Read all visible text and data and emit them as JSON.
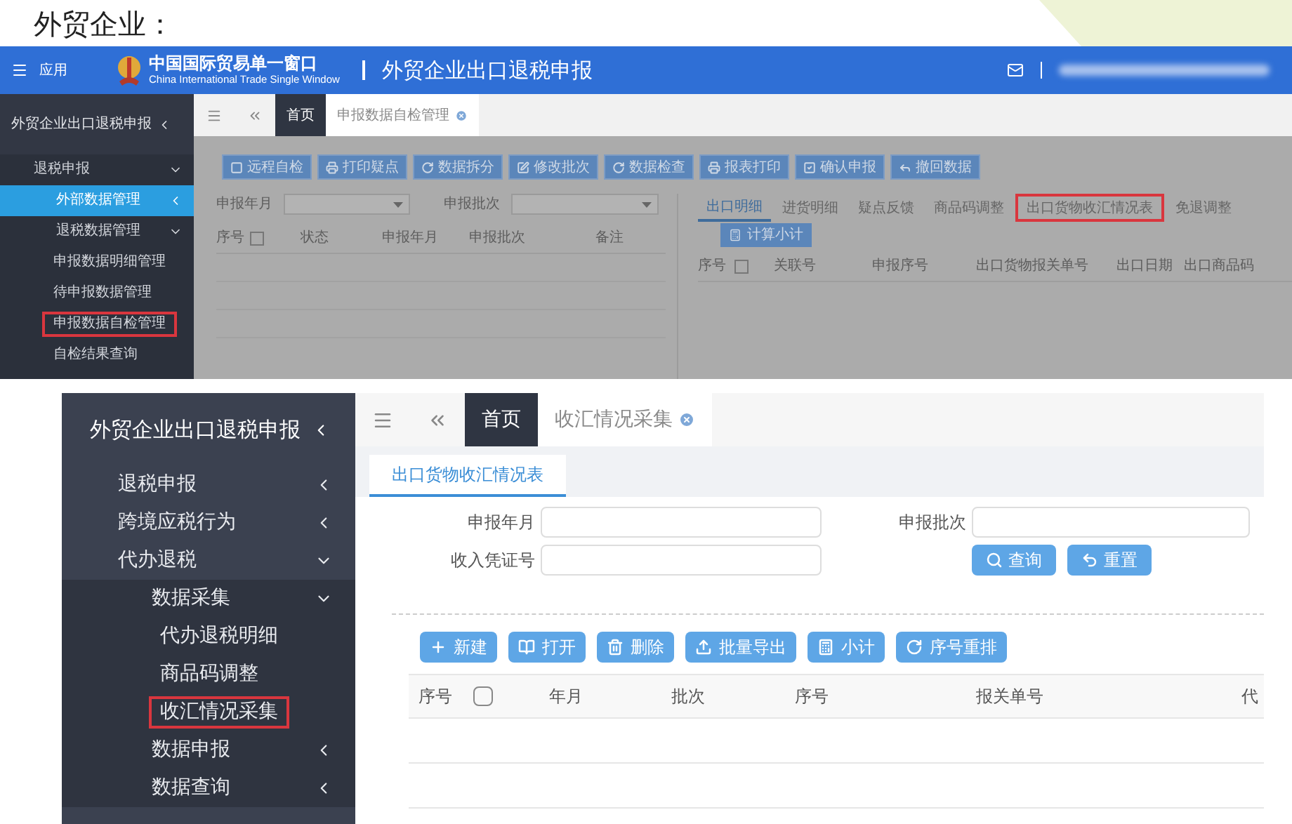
{
  "slide_title": "外贸企业：",
  "top_window": {
    "header": {
      "menu_label": "应用",
      "logo_title": "中国国际贸易单一窗口",
      "logo_subtitle": "China International Trade Single Window",
      "app_title": "外贸企业出口退税申报"
    },
    "sidebar": {
      "title": "外贸企业出口退税申报",
      "items": [
        {
          "label": "退税申报",
          "expanded": true,
          "selected": false,
          "highlighted": false,
          "children": [
            {
              "label": "外部数据管理",
              "expanded": false,
              "selected": true,
              "highlighted": false
            },
            {
              "label": "退税数据管理",
              "expanded": true,
              "selected": false,
              "highlighted": false,
              "children": [
                {
                  "label": "申报数据明细管理",
                  "selected": false,
                  "highlighted": false
                },
                {
                  "label": "待申报数据管理",
                  "selected": false,
                  "highlighted": false
                },
                {
                  "label": "申报数据自检管理",
                  "selected": false,
                  "highlighted": true
                },
                {
                  "label": "自检结果查询",
                  "selected": false,
                  "highlighted": false
                }
              ]
            }
          ]
        }
      ]
    },
    "tabs": [
      {
        "label": "首页",
        "selected": true,
        "closable": false
      },
      {
        "label": "申报数据自检管理",
        "selected": false,
        "closable": true
      }
    ],
    "toolbar": [
      {
        "label": "远程自检",
        "kind": "check"
      },
      {
        "label": "打印疑点",
        "kind": "print"
      },
      {
        "label": "数据拆分",
        "kind": "refresh"
      },
      {
        "label": "修改批次",
        "kind": "edit"
      },
      {
        "label": "数据检查",
        "kind": "refresh"
      },
      {
        "label": "报表打印",
        "kind": "print"
      },
      {
        "label": "确认申报",
        "kind": "confirm"
      },
      {
        "label": "撤回数据",
        "kind": "undo"
      }
    ],
    "filters": [
      {
        "label": "申报年月"
      },
      {
        "label": "申报批次"
      }
    ],
    "left_table": {
      "select_all_checked": false,
      "columns": [
        "序号",
        "状态",
        "申报年月",
        "申报批次",
        "备注"
      ]
    },
    "detail_tabs": [
      {
        "label": "出口明细",
        "selected": true,
        "highlighted": false
      },
      {
        "label": "进货明细",
        "selected": false,
        "highlighted": false
      },
      {
        "label": "疑点反馈",
        "selected": false,
        "highlighted": false
      },
      {
        "label": "商品码调整",
        "selected": false,
        "highlighted": false
      },
      {
        "label": "出口货物收汇情况表",
        "selected": false,
        "highlighted": true
      },
      {
        "label": "免退调整",
        "selected": false,
        "highlighted": false
      }
    ],
    "subtotal_button": "计算小计",
    "right_table": {
      "select_all_checked": false,
      "columns": [
        "序号",
        "关联号",
        "申报序号",
        "出口货物报关单号",
        "出口日期",
        "出口商品码"
      ]
    }
  },
  "bottom_window": {
    "sidebar": {
      "title": "外贸企业出口退税申报",
      "items": [
        {
          "label": "退税申报",
          "expanded": false,
          "selected": false,
          "highlighted": false
        },
        {
          "label": "跨境应税行为",
          "expanded": false,
          "selected": false,
          "highlighted": false
        },
        {
          "label": "代办退税",
          "expanded": true,
          "selected": false,
          "highlighted": false,
          "children": [
            {
              "label": "数据采集",
              "expanded": true,
              "selected": false,
              "highlighted": false,
              "children": [
                {
                  "label": "代办退税明细",
                  "selected": false,
                  "highlighted": false
                },
                {
                  "label": "商品码调整",
                  "selected": false,
                  "highlighted": false
                },
                {
                  "label": "收汇情况采集",
                  "selected": false,
                  "highlighted": true
                }
              ]
            },
            {
              "label": "数据申报",
              "expanded": false,
              "selected": false,
              "highlighted": false
            },
            {
              "label": "数据查询",
              "expanded": false,
              "selected": false,
              "highlighted": false
            }
          ]
        }
      ]
    },
    "tabs": [
      {
        "label": "首页",
        "selected": true,
        "closable": false
      },
      {
        "label": "收汇情况采集",
        "selected": false,
        "closable": true
      }
    ],
    "sheet_tabs": [
      {
        "label": "出口货物收汇情况表",
        "selected": true
      }
    ],
    "fields": [
      {
        "label": "申报年月"
      },
      {
        "label": "申报批次"
      },
      {
        "label": "收入凭证号"
      }
    ],
    "search_buttons": [
      {
        "label": "查询",
        "kind": "search"
      },
      {
        "label": "重置",
        "kind": "reset"
      }
    ],
    "toolbar": [
      {
        "label": "新建",
        "kind": "add"
      },
      {
        "label": "打开",
        "kind": "open"
      },
      {
        "label": "删除",
        "kind": "delete"
      },
      {
        "label": "批量导出",
        "kind": "export"
      },
      {
        "label": "小计",
        "kind": "subtotal"
      },
      {
        "label": "序号重排",
        "kind": "refresh"
      }
    ],
    "table": {
      "select_all_checked": false,
      "columns": [
        "序号",
        "年月",
        "批次",
        "序号",
        "报关单号",
        "代"
      ]
    }
  }
}
